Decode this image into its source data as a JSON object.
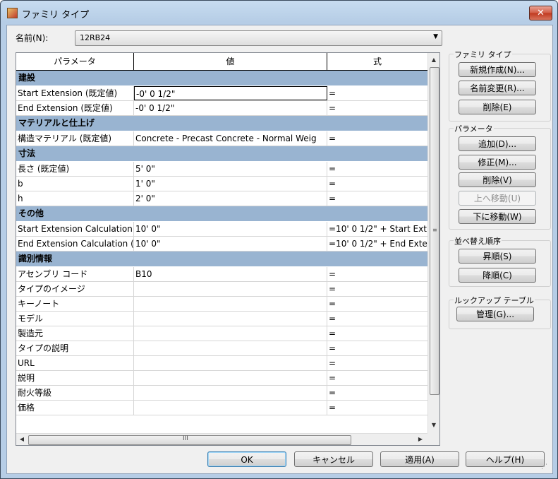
{
  "window": {
    "title": "ファミリ タイプ",
    "close_label": "✕"
  },
  "name_field": {
    "label": "名前(N):",
    "value": "12RB24"
  },
  "grid": {
    "headers": [
      "パラメータ",
      "値",
      "式"
    ],
    "groups": [
      {
        "name": "建設",
        "rows": [
          {
            "param": "Start Extension (既定値)",
            "value": "-0'  0 1/2\"",
            "formula": "="
          },
          {
            "param": "End Extension (既定値)",
            "value": "-0'  0 1/2\"",
            "formula": "="
          }
        ]
      },
      {
        "name": "マテリアルと仕上げ",
        "rows": [
          {
            "param": "構造マテリアル (既定値)",
            "value": "Concrete - Precast Concrete - Normal Weig",
            "formula": "="
          }
        ]
      },
      {
        "name": "寸法",
        "rows": [
          {
            "param": "長さ (既定値)",
            "value": "5'  0\"",
            "formula": "="
          },
          {
            "param": "b",
            "value": "1'  0\"",
            "formula": "="
          },
          {
            "param": "h",
            "value": "2'  0\"",
            "formula": "="
          }
        ]
      },
      {
        "name": "その他",
        "rows": [
          {
            "param": "Start Extension Calculation",
            "value": "10'  0\"",
            "formula": "=10'  0 1/2\" + Start Ext"
          },
          {
            "param": "End Extension Calculation (",
            "value": "10'  0\"",
            "formula": "=10'  0 1/2\" + End Exte"
          }
        ]
      },
      {
        "name": "識別情報",
        "rows": [
          {
            "param": "アセンブリ コード",
            "value": "B10",
            "formula": "="
          },
          {
            "param": "タイプのイメージ",
            "value": "",
            "formula": "="
          },
          {
            "param": "キーノート",
            "value": "",
            "formula": "="
          },
          {
            "param": "モデル",
            "value": "",
            "formula": "="
          },
          {
            "param": "製造元",
            "value": "",
            "formula": "="
          },
          {
            "param": "タイプの説明",
            "value": "",
            "formula": "="
          },
          {
            "param": "URL",
            "value": "",
            "formula": "="
          },
          {
            "param": "説明",
            "value": "",
            "formula": "="
          },
          {
            "param": "耐火等級",
            "value": "",
            "formula": "="
          },
          {
            "param": "価格",
            "value": "",
            "formula": "="
          }
        ]
      }
    ]
  },
  "family_types": {
    "title": "ファミリ タイプ",
    "new": "新規作成(N)...",
    "rename": "名前変更(R)...",
    "delete": "削除(E)"
  },
  "parameters": {
    "title": "パラメータ",
    "add": "追加(D)...",
    "modify": "修正(M)...",
    "delete": "削除(V)",
    "move_up": "上へ移動(U)",
    "move_down": "下に移動(W)"
  },
  "sort": {
    "title": "並べ替え順序",
    "ascending": "昇順(S)",
    "descending": "降順(C)"
  },
  "lookup": {
    "title": "ルックアップ テーブル",
    "manage": "管理(G)..."
  },
  "footer": {
    "ok": "OK",
    "cancel": "キャンセル",
    "apply": "適用(A)",
    "help": "ヘルプ(H)"
  },
  "icons": {
    "combo_arrow": "▼",
    "scroll_up": "▲",
    "scroll_down": "▼",
    "scroll_left": "◀",
    "scroll_right": "▶",
    "grip_v": "≡",
    "grip_h": "III",
    "resize": "⋰"
  }
}
